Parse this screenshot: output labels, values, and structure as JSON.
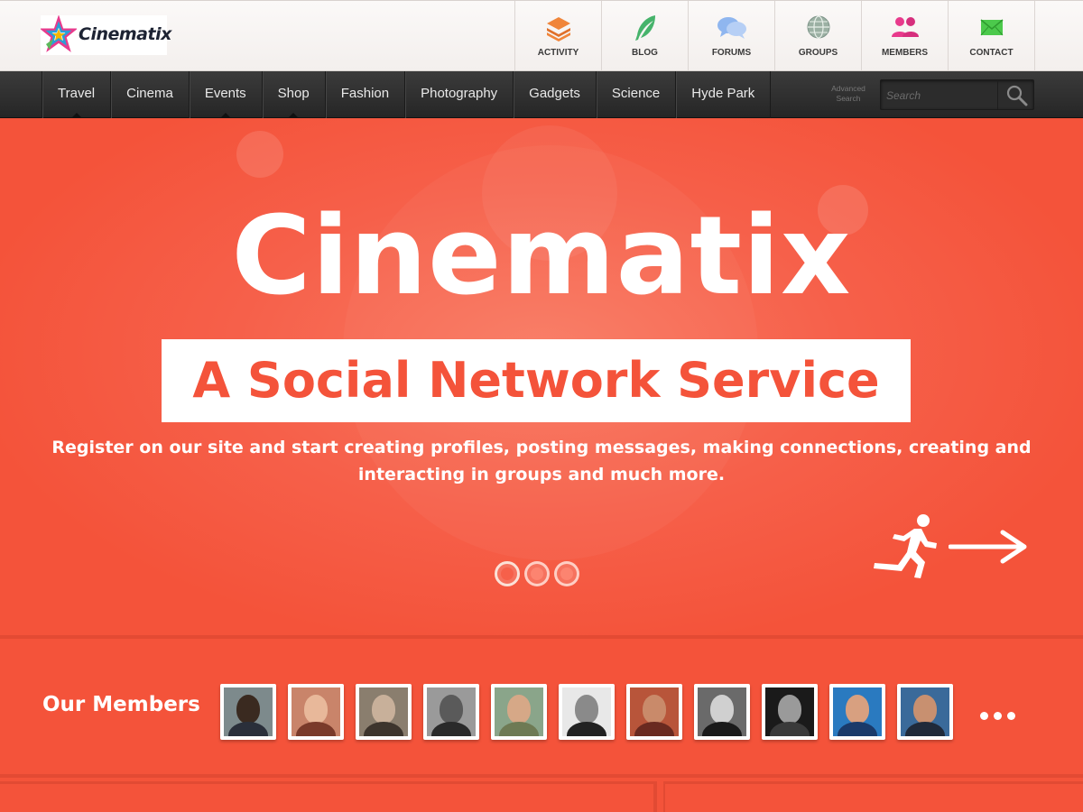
{
  "brand": {
    "name": "Cinematix"
  },
  "top_nav": [
    {
      "label": "ACTIVITY",
      "icon": "layers-icon"
    },
    {
      "label": "BLOG",
      "icon": "feather-icon"
    },
    {
      "label": "FORUMS",
      "icon": "chat-bubbles-icon"
    },
    {
      "label": "GROUPS",
      "icon": "globe-icon"
    },
    {
      "label": "MEMBERS",
      "icon": "people-icon"
    },
    {
      "label": "CONTACT",
      "icon": "envelope-icon"
    }
  ],
  "main_nav": [
    {
      "label": "Travel",
      "has_submenu": true
    },
    {
      "label": "Cinema",
      "has_submenu": false
    },
    {
      "label": "Events",
      "has_submenu": true
    },
    {
      "label": "Shop",
      "has_submenu": true
    },
    {
      "label": "Fashion",
      "has_submenu": false
    },
    {
      "label": "Photography",
      "has_submenu": false
    },
    {
      "label": "Gadgets",
      "has_submenu": false
    },
    {
      "label": "Science",
      "has_submenu": false
    },
    {
      "label": "Hyde Park",
      "has_submenu": false
    }
  ],
  "search": {
    "advanced_line1": "Advanced",
    "advanced_line2": "Search",
    "placeholder": "Search",
    "value": ""
  },
  "hero": {
    "title": "Cinematix",
    "subtitle": "A Social Network Service",
    "description": "Register on our site and start creating profiles, posting messages, making connections, creating and interacting in groups and much more.",
    "cta_icons": [
      "running-man-icon",
      "arrow-right-icon"
    ],
    "slides_total": 3,
    "active_slide": 1
  },
  "members": {
    "title": "Our Members",
    "count_shown": 11
  },
  "colors": {
    "accent": "#f4533a",
    "nav_dark": "#2e2e2e",
    "header_bg": "#f8f5f3"
  }
}
